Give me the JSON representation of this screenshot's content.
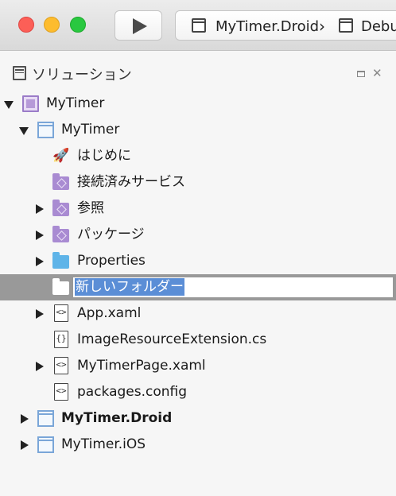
{
  "toolbar": {
    "config_project": "MyTimer.Droid",
    "config_separator": "›",
    "config_target": "Debu"
  },
  "solution_pad": {
    "title": "ソリューション",
    "maximize_icon": "maximize-icon",
    "close_icon": "close-icon",
    "close_glyph": "✕"
  },
  "tree": {
    "solution": {
      "label": "MyTimer",
      "icon": "solution-icon",
      "expanded": true
    },
    "project": {
      "label": "MyTimer",
      "icon": "project-icon",
      "expanded": true
    },
    "children": [
      {
        "label": "はじめに",
        "icon": "rocket-icon"
      },
      {
        "label": "接続済みサービス",
        "icon": "connected-services-folder-icon"
      },
      {
        "label": "参照",
        "icon": "references-folder-icon",
        "expanded": false
      },
      {
        "label": "パッケージ",
        "icon": "packages-folder-icon",
        "expanded": false
      },
      {
        "label": "Properties",
        "icon": "folder-icon",
        "expanded": false
      },
      {
        "label": "新しいフォルダー",
        "icon": "new-folder-icon",
        "editing": true
      },
      {
        "label": "App.xaml",
        "icon": "xaml-file-icon",
        "expanded": false
      },
      {
        "label": "ImageResourceExtension.cs",
        "icon": "cs-file-icon"
      },
      {
        "label": "MyTimerPage.xaml",
        "icon": "xaml-file-icon",
        "expanded": false
      },
      {
        "label": "packages.config",
        "icon": "config-file-icon"
      }
    ],
    "other_projects": [
      {
        "label": "MyTimer.Droid",
        "icon": "project-icon",
        "bold": true,
        "expanded": false
      },
      {
        "label": "MyTimer.iOS",
        "icon": "project-icon",
        "bold": false,
        "expanded": false
      }
    ]
  },
  "colors": {
    "selection_bar": "#999999",
    "rename_highlight": "#5b8ed6",
    "project_icon": "#7aa6d8",
    "purple_folder": "#a98bd2",
    "blue_folder": "#5fb4e8"
  }
}
